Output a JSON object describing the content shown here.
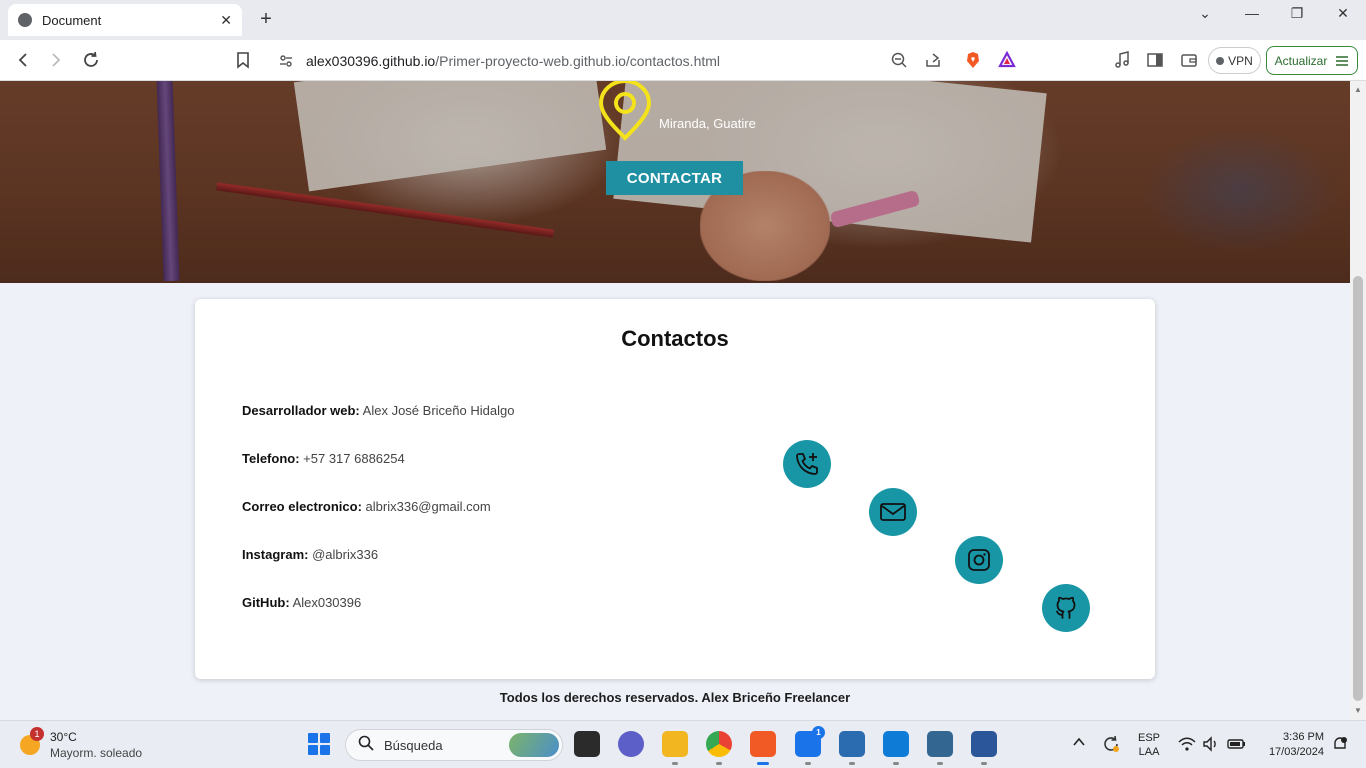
{
  "browser": {
    "tab_title": "Document",
    "tab_close": "✕",
    "new_tab": "+",
    "window_controls": {
      "minimize": "⌄",
      "restore": "—",
      "maximize": "❐",
      "close": "✕"
    },
    "url_host": "alex030396.github.io",
    "url_path": "/Primer-proyecto-web.github.io/contactos.html",
    "vpn_label": "VPN",
    "update_label": "Actualizar"
  },
  "hero": {
    "location": "Miranda, Guatire",
    "contact_button": "CONTACTAR"
  },
  "contacts": {
    "title": "Contactos",
    "rows": [
      {
        "label": "Desarrollador web:",
        "value": "Alex José Briceño Hidalgo"
      },
      {
        "label": "Telefono:",
        "value": "+57 317 6886254"
      },
      {
        "label": "Correo electronico:",
        "value": "albrix336@gmail.com"
      },
      {
        "label": "Instagram:",
        "value": "@albrix336"
      },
      {
        "label": "GitHub:",
        "value": "Alex030396"
      }
    ],
    "icons": [
      "phone-icon",
      "mail-icon",
      "instagram-icon",
      "github-icon"
    ],
    "accent_color": "#1996a6"
  },
  "footer": {
    "text": "Todos los derechos reservados. Alex Briceño Freelancer"
  },
  "taskbar": {
    "weather_badge": "1",
    "temperature": "30°C",
    "condition": "Mayorm. soleado",
    "search_placeholder": "Búsqueda",
    "lang_top": "ESP",
    "lang_bottom": "LAA",
    "time": "3:36 PM",
    "date": "17/03/2024",
    "app_badges": {
      "outlook": "1"
    }
  }
}
